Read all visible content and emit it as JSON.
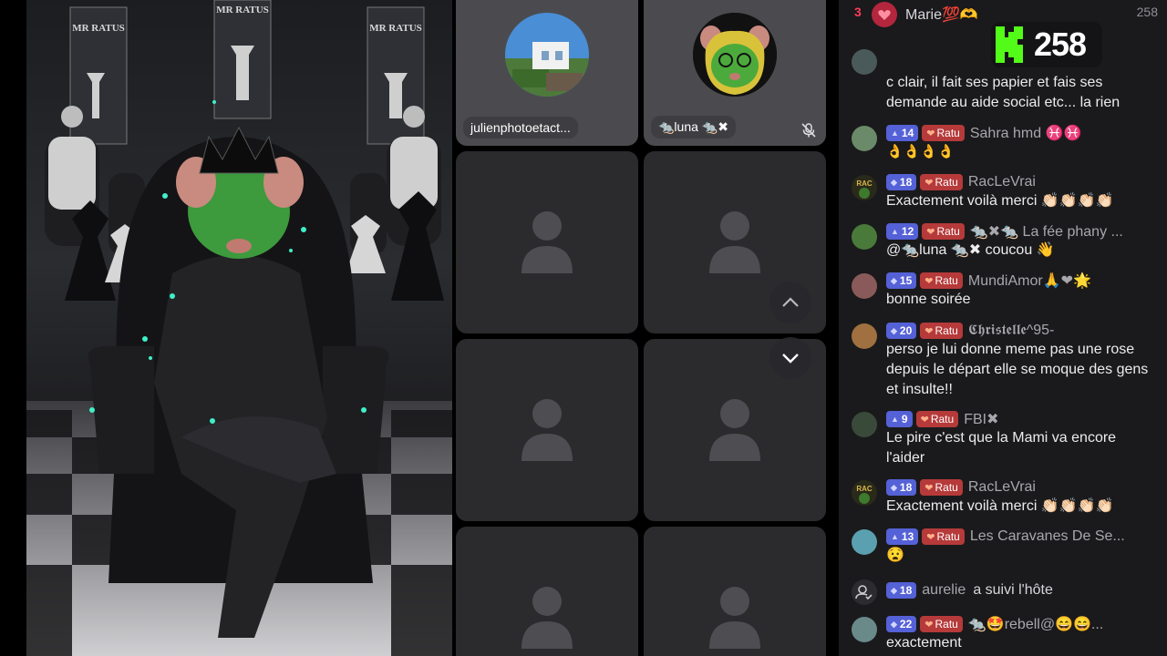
{
  "host": {
    "banner_text_left": "MR RATUS",
    "banner_text_center": "MR RATUS",
    "banner_text_right": "MR RATUS"
  },
  "guests": [
    {
      "name": "julienphotoetact...",
      "has_photo": true
    },
    {
      "name": "🐀luna 🐀✖",
      "has_photo": true,
      "muted": true
    }
  ],
  "empty_slots": 6,
  "chat": {
    "top_rank": "3",
    "top_user": "Marie💯🫶",
    "viewer_count": "258",
    "kick_count": "258",
    "messages": [
      {
        "partial_text": "c clair, il fait ses papier et fais ses demande au aide social etc... la rien"
      },
      {
        "level": "14",
        "fan": "Ratu",
        "user": "Sahra hmd ♓♓",
        "text": "👌👌👌👌"
      },
      {
        "level": "18",
        "fan": "Ratu",
        "user": "RacLeVrai",
        "text": "Exactement voilà merci 👏🏻👏🏻👏🏻👏🏻"
      },
      {
        "level": "12",
        "fan": "Ratu",
        "user": "🐀✖🐀 La fée phany ...",
        "text": "@🐀luna 🐀✖ coucou 👋"
      },
      {
        "level": "15",
        "fan": "Ratu",
        "user": "MundiAmor🙏❤🌟",
        "text": "bonne soirée"
      },
      {
        "level": "20",
        "fan": "Ratu",
        "user": "𝕮𝖍𝖗𝖎𝖘𝖙𝖊𝖑𝖑𝖊^95-",
        "text": "perso je lui donne meme pas une rose depuis le départ elle se moque des gens et insulte!!"
      },
      {
        "level": "9",
        "fan": "Ratu",
        "user": "FBI✖",
        "text": "Le pire c'est que la Mami va encore l'aider"
      },
      {
        "level": "18",
        "fan": "Ratu",
        "user": "RacLeVrai",
        "text": "Exactement voilà merci 👏🏻👏🏻👏🏻👏🏻"
      },
      {
        "level": "13",
        "fan": "Ratu",
        "user": "Les Caravanes De Se...",
        "text": "😧"
      },
      {
        "level": "18",
        "user": "aurelie",
        "action": "a suivi l'hôte"
      },
      {
        "level": "22",
        "fan": "Ratu",
        "user": "🐀🤩rebell@😄😄...",
        "text": "exactement"
      }
    ]
  },
  "colors": {
    "level_badge": "#5561d6",
    "fan_badge": "#b63a3a",
    "kick_green": "#53fc18",
    "chat_bg": "#1a1a1c"
  }
}
